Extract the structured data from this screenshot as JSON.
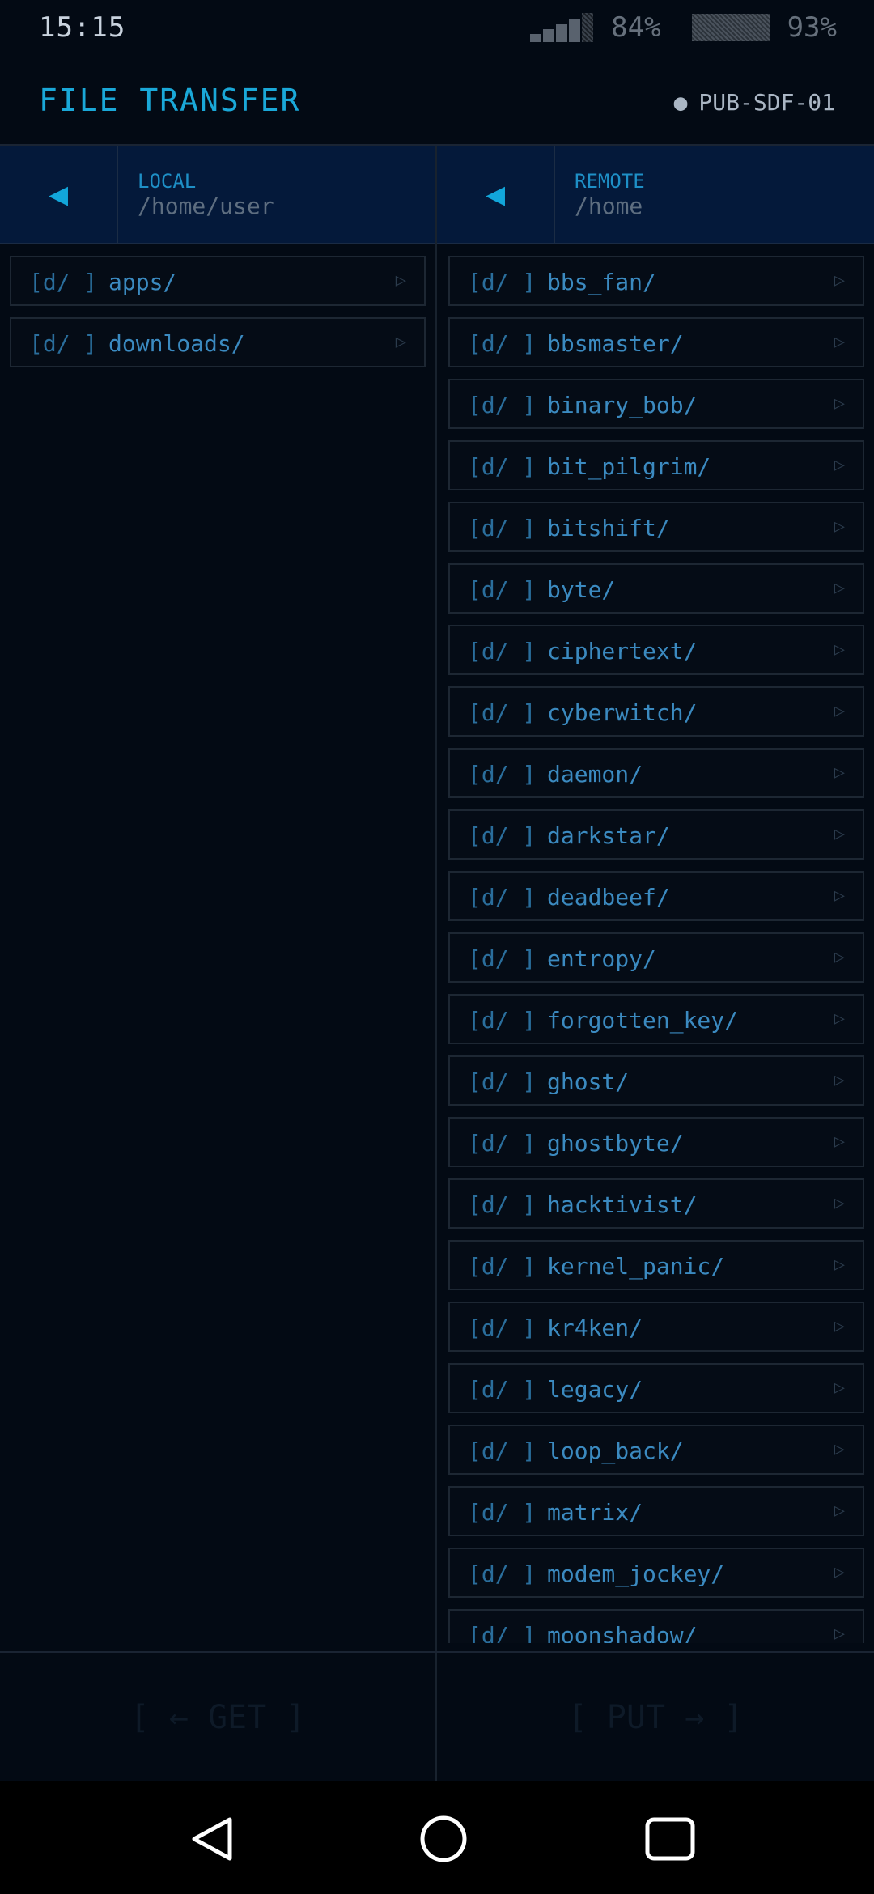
{
  "status": {
    "time": "15:15",
    "signal_percent": "84%",
    "battery_percent": "93%"
  },
  "header": {
    "title": "FILE TRANSFER",
    "server": "PUB-SDF-01"
  },
  "local": {
    "label": "LOCAL",
    "path": "/home/user",
    "back_icon": "◀",
    "items": [
      {
        "tag": "[d/ ]",
        "name": "apps/"
      },
      {
        "tag": "[d/ ]",
        "name": "downloads/"
      }
    ]
  },
  "remote": {
    "label": "REMOTE",
    "path": "/home",
    "back_icon": "◀",
    "items": [
      {
        "tag": "[d/ ]",
        "name": "bbs_fan/"
      },
      {
        "tag": "[d/ ]",
        "name": "bbsmaster/"
      },
      {
        "tag": "[d/ ]",
        "name": "binary_bob/"
      },
      {
        "tag": "[d/ ]",
        "name": "bit_pilgrim/"
      },
      {
        "tag": "[d/ ]",
        "name": "bitshift/"
      },
      {
        "tag": "[d/ ]",
        "name": "byte/"
      },
      {
        "tag": "[d/ ]",
        "name": "ciphertext/"
      },
      {
        "tag": "[d/ ]",
        "name": "cyberwitch/"
      },
      {
        "tag": "[d/ ]",
        "name": "daemon/"
      },
      {
        "tag": "[d/ ]",
        "name": "darkstar/"
      },
      {
        "tag": "[d/ ]",
        "name": "deadbeef/"
      },
      {
        "tag": "[d/ ]",
        "name": "entropy/"
      },
      {
        "tag": "[d/ ]",
        "name": "forgotten_key/"
      },
      {
        "tag": "[d/ ]",
        "name": "ghost/"
      },
      {
        "tag": "[d/ ]",
        "name": "ghostbyte/"
      },
      {
        "tag": "[d/ ]",
        "name": "hacktivist/"
      },
      {
        "tag": "[d/ ]",
        "name": "kernel_panic/"
      },
      {
        "tag": "[d/ ]",
        "name": "kr4ken/"
      },
      {
        "tag": "[d/ ]",
        "name": "legacy/"
      },
      {
        "tag": "[d/ ]",
        "name": "loop_back/"
      },
      {
        "tag": "[d/ ]",
        "name": "matrix/"
      },
      {
        "tag": "[d/ ]",
        "name": "modem_jockey/"
      },
      {
        "tag": "[d/ ]",
        "name": "moonshadow/"
      }
    ]
  },
  "row_arrow": "▷",
  "actions": {
    "get": "[ ← GET ]",
    "put": "[ PUT → ]"
  },
  "colors": {
    "accent": "#1aa8d8",
    "background": "#030a14",
    "pane_header": "#04193a"
  }
}
